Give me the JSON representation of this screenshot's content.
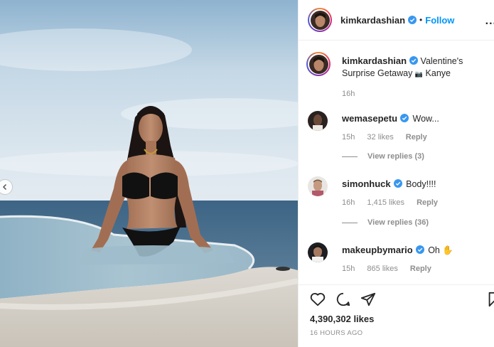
{
  "post": {
    "username": "kimkardashian",
    "follow_label": "Follow",
    "dot": "•",
    "more": "..."
  },
  "caption": {
    "username": "kimkardashian",
    "text_before_emoji": "Valentine's Surprise Getaway",
    "camera_emoji": "📷",
    "text_after_emoji": "Kanye",
    "time": "16h"
  },
  "comments": [
    {
      "username": "wemasepetu",
      "text": "Wow...",
      "time": "15h",
      "likes": "32 likes",
      "reply": "Reply",
      "view_replies": "View replies (3)"
    },
    {
      "username": "simonhuck",
      "text": "Body!!!!",
      "time": "16h",
      "likes": "1,415 likes",
      "reply": "Reply",
      "view_replies": "View replies (36)"
    },
    {
      "username": "makeupbymario",
      "text": "Oh",
      "emoji": "✋",
      "time": "15h",
      "likes": "865 likes",
      "reply": "Reply"
    }
  ],
  "footer": {
    "likes": "4,390,302 likes",
    "time": "16 HOURS AGO"
  },
  "colors": {
    "link_blue": "#0095f6",
    "verified_blue": "#3897f0",
    "muted": "#8e8e8e",
    "text": "#262626",
    "divider": "#efefef"
  },
  "icons": [
    "chevron-left-icon",
    "verified-badge-icon",
    "heart-icon",
    "comment-icon",
    "share-icon",
    "bookmark-icon"
  ]
}
